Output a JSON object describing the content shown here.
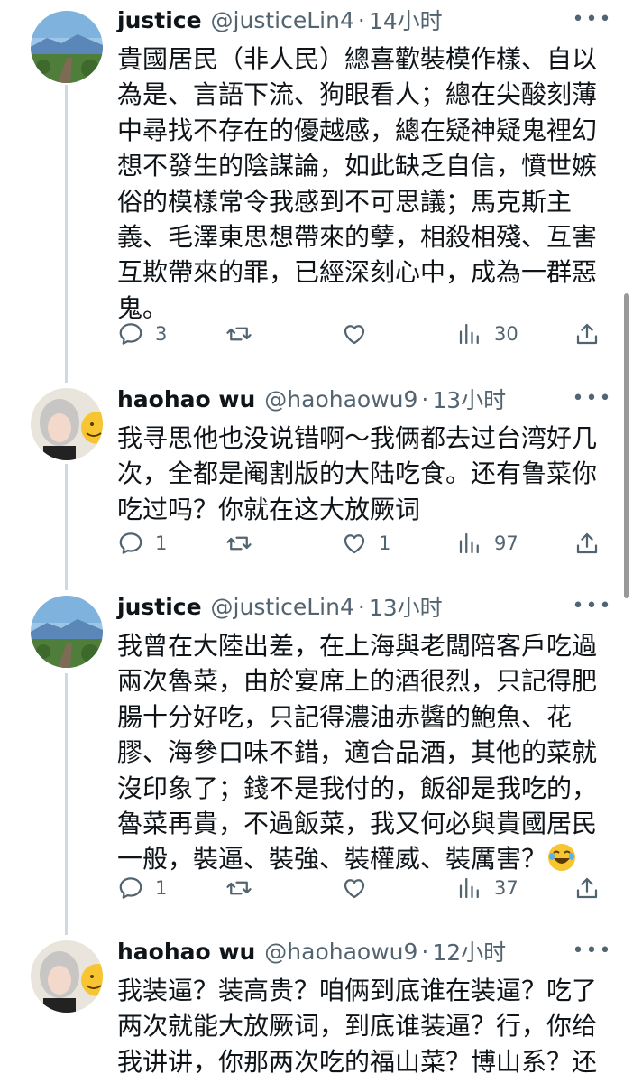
{
  "tweets": [
    {
      "name": "justice",
      "handle": "@justiceLin4",
      "time": "14小时",
      "text": "貴國居民（非人民）總喜歡裝模作樣、自以為是、言語下流、狗眼看人；總在尖酸刻薄中尋找不存在的優越感，總在疑神疑鬼裡幻想不發生的陰謀論，如此缺乏自信，憤世嫉俗的模樣常令我感到不可思議；馬克斯主義、毛澤東思想帶來的孽，相殺相殘、互害互欺帶來的罪，已經深刻心中，成為一群惡鬼。",
      "replies": "3",
      "retweets": "",
      "likes": "",
      "views": "30"
    },
    {
      "name": "haohao wu",
      "handle": "@haohaowu9",
      "time": "13小时",
      "text": "我寻思他也没说错啊～我俩都去过台湾好几次，全都是阉割版的大陆吃食。还有鲁菜你吃过吗？你就在这大放厥词",
      "replies": "1",
      "retweets": "",
      "likes": "1",
      "views": "97"
    },
    {
      "name": "justice",
      "handle": "@justiceLin4",
      "time": "13小时",
      "text": "我曾在大陸出差，在上海與老闆陪客戶吃過兩次魯菜，由於宴席上的酒很烈，只記得肥腸十分好吃，只記得濃油赤醬的鮑魚、花膠、海參口味不錯，適合品酒，其他的菜就沒印象了；錢不是我付的，飯卻是我吃的，魯菜再貴，不過飯菜，我又何必與貴國居民一般，裝逼、裝強、裝權威、裝厲害？",
      "emoji": "face-with-tears-of-joy",
      "replies": "1",
      "retweets": "",
      "likes": "",
      "views": "37"
    },
    {
      "name": "haohao wu",
      "handle": "@haohaowu9",
      "time": "12小时",
      "text": "我装逼？装高贵？咱俩到底谁在装逼？吃了两次就能大放厥词，到底谁装逼？行，你给我讲讲，你那两次吃的福山菜？博山系？还"
    }
  ],
  "icons": {
    "reply": "reply-icon",
    "retweet": "retweet-icon",
    "like": "like-icon",
    "views": "views-icon",
    "share": "share-icon",
    "more": "more-icon"
  },
  "colors": {
    "text": "#0f1419",
    "secondary": "#536471",
    "thread_line": "#cfd9de"
  }
}
